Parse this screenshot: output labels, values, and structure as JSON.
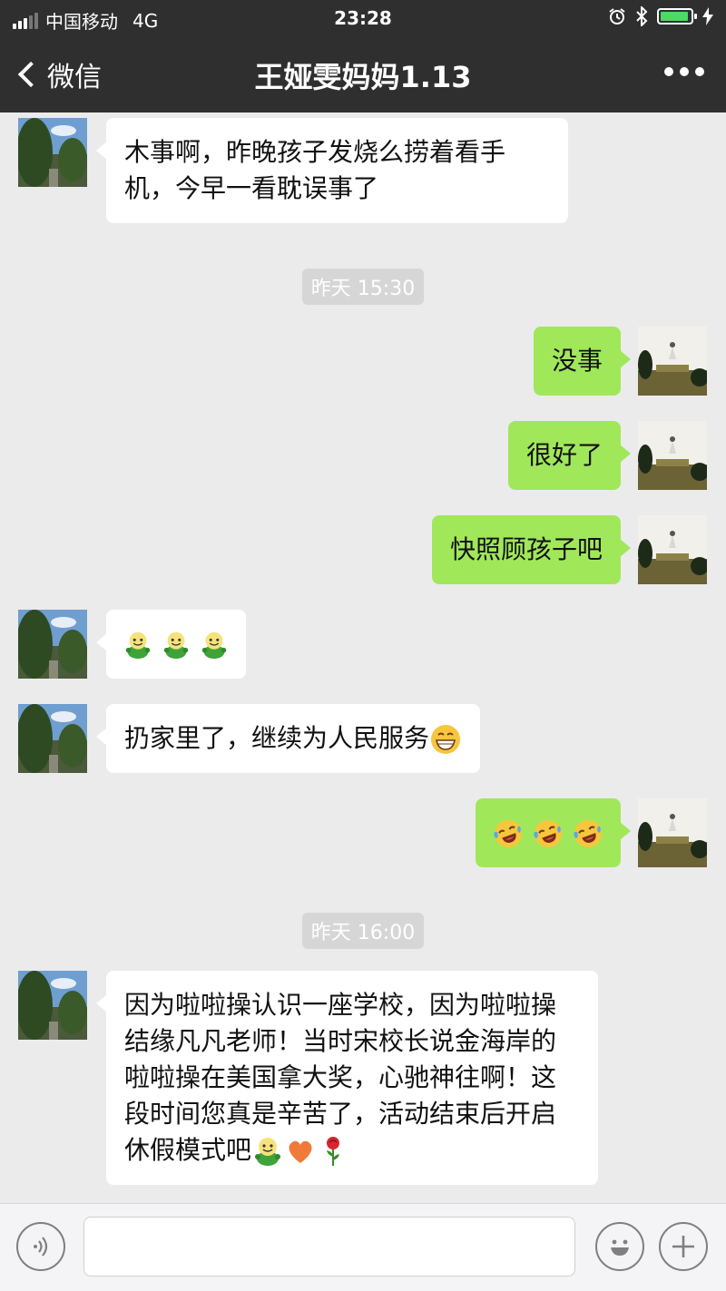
{
  "status_bar": {
    "carrier": "中国移动",
    "network": "4G",
    "time": "23:28",
    "battery_color": "#4cd964"
  },
  "nav": {
    "back_label": "微信",
    "title": "王娅雯妈妈1.13",
    "more_icon": "more-dots-icon"
  },
  "messages": [
    {
      "from": "other",
      "text": "木事啊，昨晚孩子发烧么捞着看手机，今早一看耽误事了"
    },
    {
      "from": "system",
      "text": "昨天 15:30"
    },
    {
      "from": "me",
      "text": "没事"
    },
    {
      "from": "me",
      "text": "很好了"
    },
    {
      "from": "me",
      "text": "快照顾孩子吧"
    },
    {
      "from": "other",
      "emojis": [
        "smile-bot-emoji",
        "smile-bot-emoji",
        "smile-bot-emoji"
      ]
    },
    {
      "from": "other",
      "text": "扔家里了，继续为人民服务",
      "trailing_emoji": "grin-emoji"
    },
    {
      "from": "me",
      "emojis": [
        "laugh-cry-emoji",
        "laugh-cry-emoji",
        "laugh-cry-emoji"
      ]
    },
    {
      "from": "system",
      "text": "昨天 16:00"
    },
    {
      "from": "other",
      "text": "因为啦啦操认识一座学校，因为啦啦操结缘凡凡老师！当时宋校长说金海岸的啦啦操在美国拿大奖，心驰神往啊！这段时间您真是辛苦了，活动结束后开启休假模式吧",
      "trailing_emojis": [
        "smile-bot-emoji",
        "heart-emoji",
        "rose-emoji"
      ]
    }
  ],
  "colors": {
    "header_bg": "#2f2f2f",
    "chat_bg": "#ebebeb",
    "my_bubble": "#a0e75a",
    "their_bubble": "#ffffff"
  },
  "input_bar": {
    "voice_icon": "voice-icon",
    "emoji_icon": "emoji-icon",
    "plus_icon": "plus-icon",
    "input_value": ""
  }
}
